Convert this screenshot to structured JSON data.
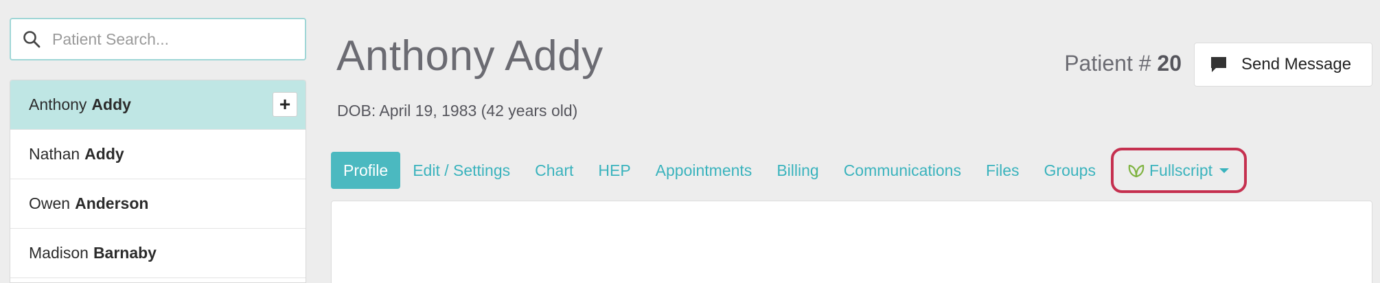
{
  "search": {
    "placeholder": "Patient Search...",
    "value": ""
  },
  "patients": [
    {
      "first": "Anthony",
      "last": "Addy",
      "active": true
    },
    {
      "first": "Nathan",
      "last": "Addy",
      "active": false
    },
    {
      "first": "Owen",
      "last": "Anderson",
      "active": false
    },
    {
      "first": "Madison",
      "last": "Barnaby",
      "active": false
    }
  ],
  "add_button_label": "+",
  "header": {
    "patient_name": "Anthony Addy",
    "dob": "DOB: April 19, 1983 (42 years old)",
    "patient_number_label": "Patient #",
    "patient_number": "20",
    "send_message_label": "Send Message"
  },
  "tabs": [
    {
      "label": "Profile",
      "active": true
    },
    {
      "label": "Edit / Settings",
      "active": false
    },
    {
      "label": "Chart",
      "active": false
    },
    {
      "label": "HEP",
      "active": false
    },
    {
      "label": "Appointments",
      "active": false
    },
    {
      "label": "Billing",
      "active": false
    },
    {
      "label": "Communications",
      "active": false
    },
    {
      "label": "Files",
      "active": false
    },
    {
      "label": "Groups",
      "active": false
    }
  ],
  "fullscript_tab": {
    "label": "Fullscript"
  },
  "icons": {
    "search": "search-icon",
    "chat": "chat-bubble-icon",
    "leaf": "leaf-icon",
    "caret": "caret-down-icon"
  },
  "colors": {
    "accent": "#4bb9c0",
    "link": "#3ab3bd",
    "active_row": "#bfe6e4",
    "highlight_border": "#c5304f",
    "leaf_green": "#7fb341"
  }
}
